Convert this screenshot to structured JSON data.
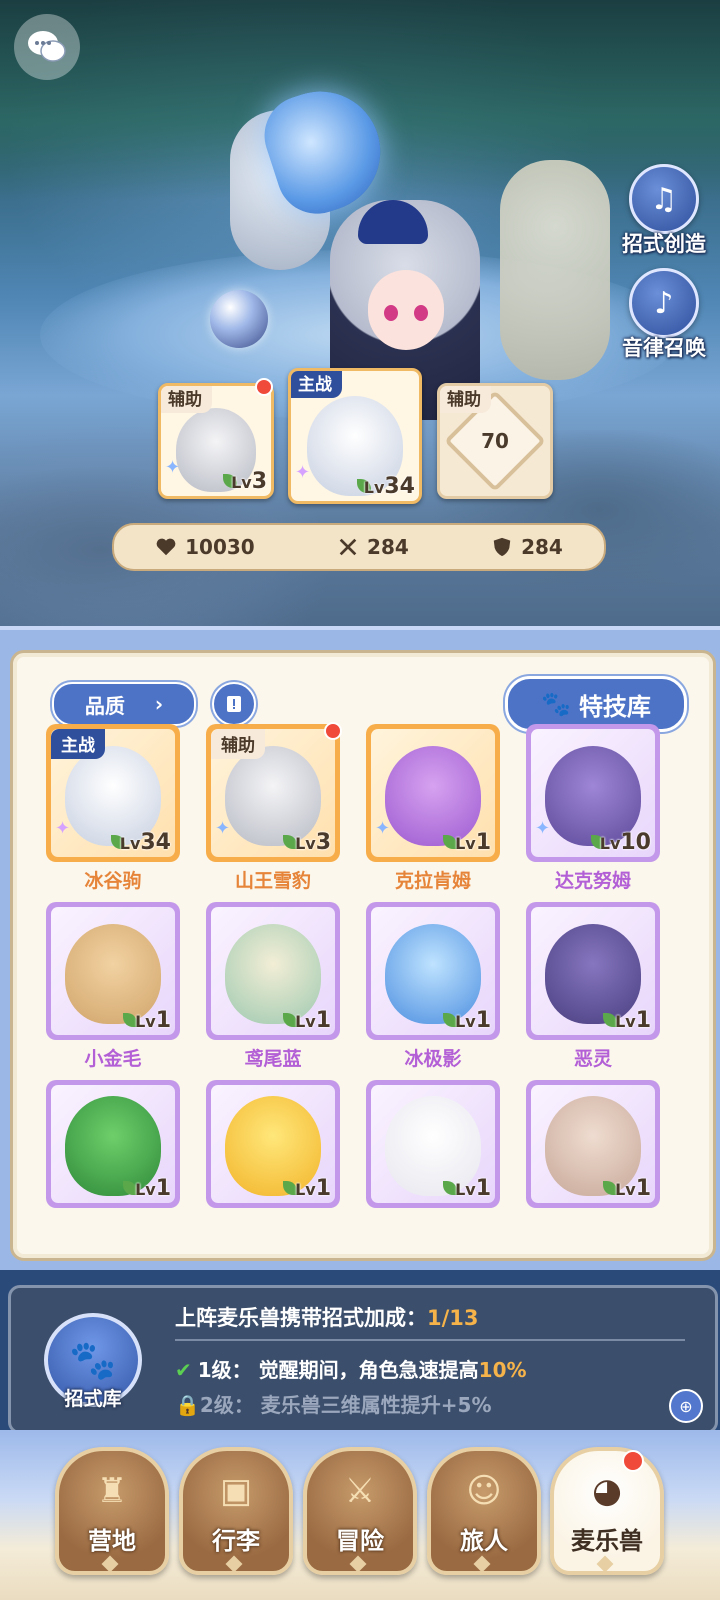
{
  "side_buttons": [
    {
      "label": "招式创造",
      "icon": "music-book-icon"
    },
    {
      "label": "音律召唤",
      "icon": "lyre-icon"
    }
  ],
  "team": {
    "left": {
      "tag": "辅助",
      "level": "3"
    },
    "center": {
      "tag": "主战",
      "level": "34"
    },
    "right": {
      "tag": "辅助",
      "unlock_level": "70"
    }
  },
  "stats": {
    "hp": "10030",
    "attack": "284",
    "defense": "284"
  },
  "filter": {
    "quality_label": "品质",
    "skill_lib_label": "特技库"
  },
  "pets": [
    {
      "name": "冰谷驹",
      "level": "34",
      "rarity": "orange",
      "tag": "主战"
    },
    {
      "name": "山王雪豹",
      "level": "3",
      "rarity": "orange",
      "tag": "辅助"
    },
    {
      "name": "克拉肯姆",
      "level": "1",
      "rarity": "orange",
      "tag": ""
    },
    {
      "name": "达克努姆",
      "level": "10",
      "rarity": "purple",
      "tag": ""
    },
    {
      "name": "小金毛",
      "level": "1",
      "rarity": "purple",
      "tag": ""
    },
    {
      "name": "鸢尾蓝",
      "level": "1",
      "rarity": "purple",
      "tag": ""
    },
    {
      "name": "冰极影",
      "level": "1",
      "rarity": "purple",
      "tag": ""
    },
    {
      "name": "恶灵",
      "level": "1",
      "rarity": "purple",
      "tag": ""
    },
    {
      "name": "",
      "level": "1",
      "rarity": "purple",
      "tag": ""
    },
    {
      "name": "",
      "level": "1",
      "rarity": "purple",
      "tag": ""
    },
    {
      "name": "",
      "level": "1",
      "rarity": "purple",
      "tag": ""
    },
    {
      "name": "",
      "level": "1",
      "rarity": "purple",
      "tag": ""
    }
  ],
  "info": {
    "icon_label": "招式库",
    "title": "上阵麦乐兽携带招式加成：",
    "progress": "1/13",
    "line1_level": "1级：",
    "line1_text": "觉醒期间，角色急速提高",
    "line1_value": "10%",
    "line2_level": "2级：",
    "line2_text": "麦乐兽三维属性提升+5%"
  },
  "nav": [
    {
      "label": "营地",
      "icon": "castle-icon"
    },
    {
      "label": "行李",
      "icon": "bag-icon"
    },
    {
      "label": "冒险",
      "icon": "crossed-swords-icon"
    },
    {
      "label": "旅人",
      "icon": "traveler-icon"
    },
    {
      "label": "麦乐兽",
      "icon": "pet-icon"
    }
  ],
  "colors": {
    "accent": "#4d73c6",
    "orange_rarity": "#f7ae4a",
    "purple_rarity": "#c398ea"
  }
}
